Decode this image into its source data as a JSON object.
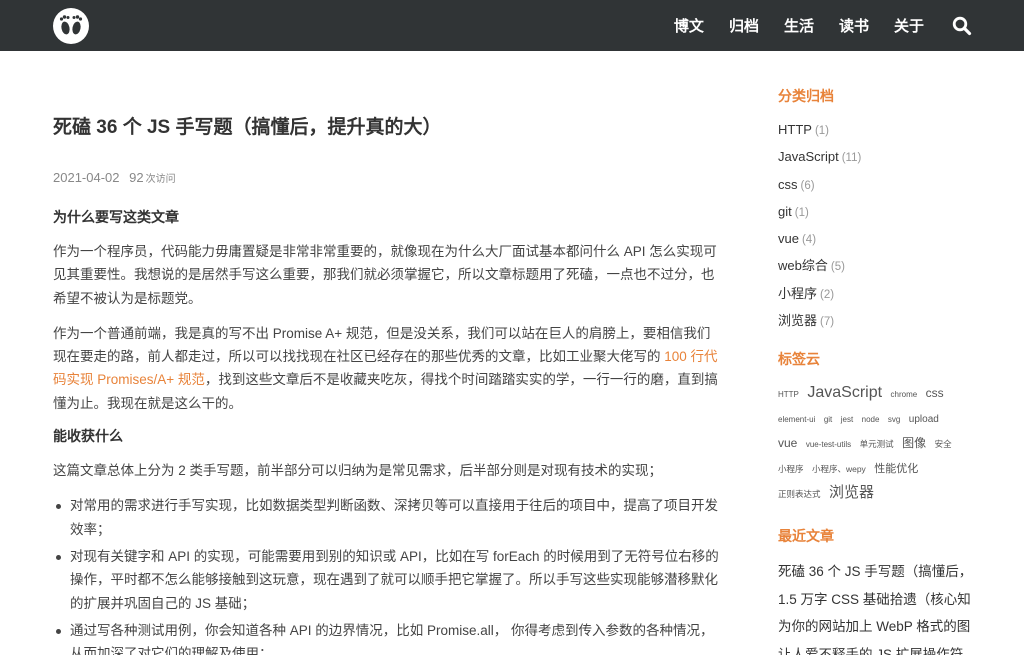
{
  "nav": {
    "items": [
      {
        "label": "博文"
      },
      {
        "label": "归档"
      },
      {
        "label": "生活"
      },
      {
        "label": "读书"
      },
      {
        "label": "关于"
      }
    ],
    "search_icon": "search-icon",
    "logo_icon": "footprints-logo-icon"
  },
  "article": {
    "title": "死磕 36 个 JS 手写题（搞懂后，提升真的大）",
    "date": "2021-04-02",
    "views": "92",
    "views_unit": "次访问",
    "h_why": "为什么要写这类文章",
    "p1": "作为一个程序员，代码能力毋庸置疑是非常非常重要的，就像现在为什么大厂面试基本都问什么 API 怎么实现可见其重要性。我想说的是居然手写这么重要，那我们就必须掌握它，所以文章标题用了死磕，一点也不过分，也希望不被认为是标题党。",
    "p2_before": "作为一个普通前端，我是真的写不出 Promise A+ 规范，但是没关系，我们可以站在巨人的肩膀上，要相信我们现在要走的路，前人都走过，所以可以找找现在社区已经存在的那些优秀的文章，比如工业聚大佬写的 ",
    "p2_link": "100 行代码实现 Promises/A+ 规范",
    "p2_after": "，找到这些文章后不是收藏夹吃灰，得找个时间踏踏实实的学，一行一行的磨，直到搞懂为止。我现在就是这么干的。",
    "h_gain": "能收获什么",
    "p3": "这篇文章总体上分为 2 类手写题，前半部分可以归纳为是常见需求，后半部分则是对现有技术的实现；",
    "bullets": [
      "对常用的需求进行手写实现，比如数据类型判断函数、深拷贝等可以直接用于往后的项目中，提高了项目开发效率；",
      "对现有关键字和 API 的实现，可能需要用到别的知识或 API，比如在写 forEach 的时候用到了无符号位右移的操作，平时都不怎么能够接触到这玩意，现在遇到了就可以顺手把它掌握了。所以手写这些实现能够潜移默化的扩展并巩固自己的 JS 基础；",
      "通过写各种测试用例，你会知道各种 API 的边界情况，比如 Promise.all， 你得考虑到传入参数的各种情况，从而加深了对它们的理解及使用；"
    ]
  },
  "sidebar": {
    "categories_title": "分类归档",
    "categories": [
      {
        "name": "HTTP",
        "count": "(1)"
      },
      {
        "name": "JavaScript",
        "count": "(11)"
      },
      {
        "name": "css",
        "count": "(6)"
      },
      {
        "name": "git",
        "count": "(1)"
      },
      {
        "name": "vue",
        "count": "(4)"
      },
      {
        "name": "web综合",
        "count": "(5)"
      },
      {
        "name": "小程序",
        "count": "(2)"
      },
      {
        "name": "浏览器",
        "count": "(7)"
      }
    ],
    "tags_title": "标签云",
    "tags": [
      {
        "name": "HTTP",
        "size": 8
      },
      {
        "name": "JavaScript",
        "size": 16
      },
      {
        "name": "chrome",
        "size": 8
      },
      {
        "name": "css",
        "size": 12
      },
      {
        "name": "element-ui",
        "size": 8
      },
      {
        "name": "git",
        "size": 8
      },
      {
        "name": "jest",
        "size": 8
      },
      {
        "name": "node",
        "size": 8
      },
      {
        "name": "svg",
        "size": 8
      },
      {
        "name": "upload",
        "size": 10
      },
      {
        "name": "vue",
        "size": 12
      },
      {
        "name": "vue-test-utils",
        "size": 8
      },
      {
        "name": "单元测试",
        "size": 8.5
      },
      {
        "name": "图像",
        "size": 12
      },
      {
        "name": "安全",
        "size": 8.5
      },
      {
        "name": "小程序",
        "size": 8.5
      },
      {
        "name": "小程序、wepy",
        "size": 8.5
      },
      {
        "name": "性能优化",
        "size": 11
      },
      {
        "name": "正则表达式",
        "size": 8.5
      },
      {
        "name": "浏览器",
        "size": 15
      }
    ],
    "recent_title": "最近文章",
    "recent": [
      "死磕 36 个 JS 手写题（搞懂后，",
      "1.5 万字 CSS 基础拾遗（核心知",
      "为你的网站加上 WebP 格式的图",
      "让人爱不释手的 JS 扩展操作符"
    ]
  },
  "colors": {
    "topbar": "#303436",
    "accent": "#e8833a",
    "text": "#333333",
    "muted": "#999999"
  }
}
